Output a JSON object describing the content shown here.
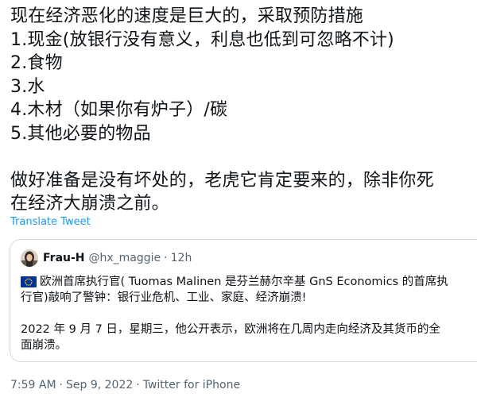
{
  "tweet": {
    "lines": [
      "现在经济恶化的速度是巨大的，采取预防措施",
      "1.现金(放银行没有意义，利息也低到可忽略不计)",
      "2.食物",
      "3.水",
      "4.木材（如果你有炉子）/碳",
      "5.其他必要的物品",
      "做好准备是没有坏处的，老虎它肯定要来的，除非你死",
      "在经济大崩溃之前。"
    ],
    "translate_label": "Translate Tweet"
  },
  "quote": {
    "author_name": "Frau-H",
    "author_handle": "@hx_maggie",
    "separator": "·",
    "time_ago": "12h",
    "flag_icon": "eu-flag-icon",
    "lines": [
      "欧洲首席执行官( Tuomas Malinen 是芬兰赫尔辛基 GnS Economics 的首席执",
      "行官)敲响了警钟：银行业危机、工业、家庭、经济崩溃!",
      "2022 年 9 月 7 日，星期三，他公开表示，欧洲将在几周内走向经济及其货币的全",
      "面崩溃。"
    ]
  },
  "meta": {
    "time": "7:59 AM",
    "separator": "·",
    "date": "Sep 9, 2022",
    "source": "Twitter for iPhone"
  },
  "colors": {
    "text": "#0f1419",
    "secondary": "#536471",
    "link": "#1d9bf0",
    "border": "#cfd9de",
    "eu_blue": "#003399",
    "eu_star": "#ffcc00"
  }
}
